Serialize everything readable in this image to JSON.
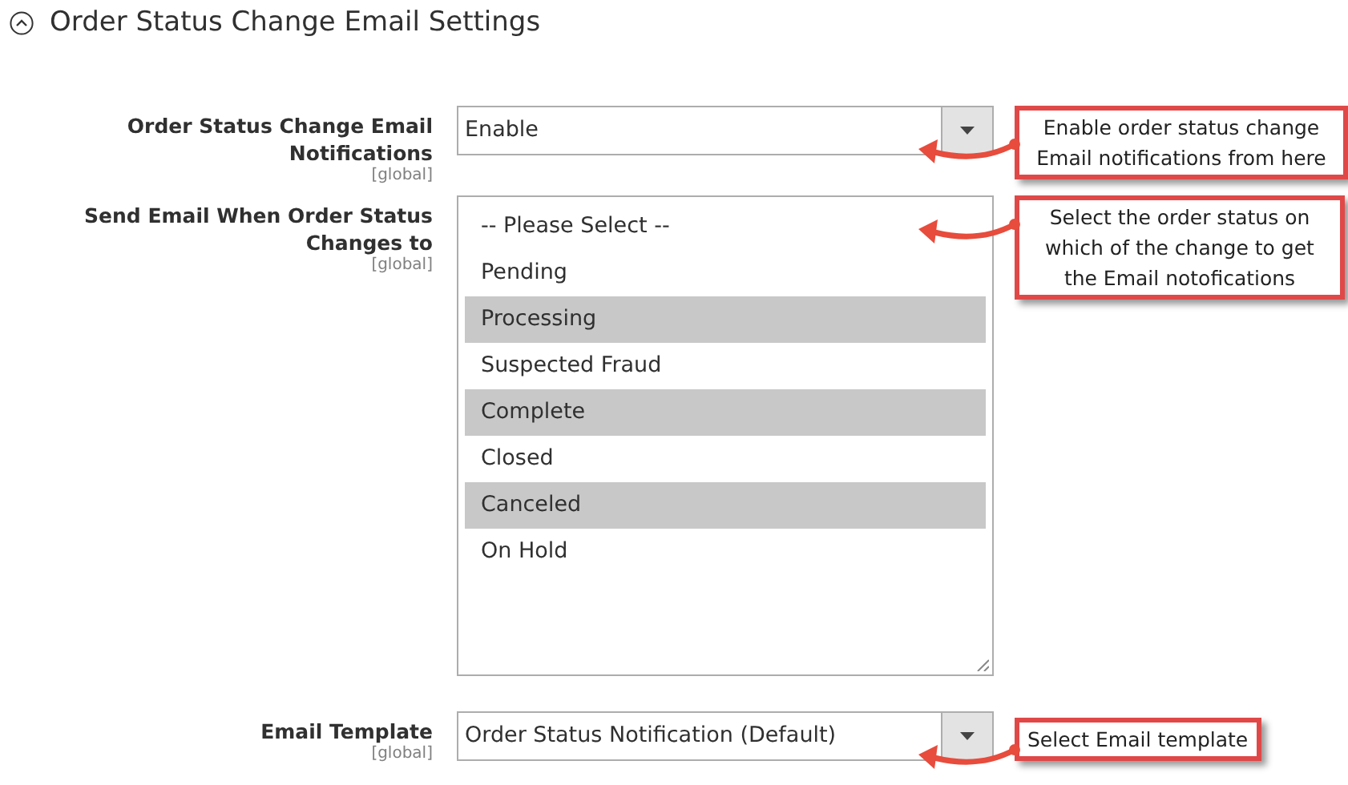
{
  "section": {
    "title": "Order Status Change Email Settings",
    "expanded": true
  },
  "fields": [
    {
      "kind": "select",
      "label": "Order Status Change Email Notifications",
      "scope": "[global]",
      "value": "Enable",
      "callout": "Enable order status change Email notifications from here"
    },
    {
      "kind": "multiselect",
      "label": "Send Email When Order Status Changes to",
      "scope": "[global]",
      "options": [
        {
          "label": "-- Please Select --",
          "selected": false
        },
        {
          "label": "Pending",
          "selected": false
        },
        {
          "label": "Processing",
          "selected": true
        },
        {
          "label": "Suspected Fraud",
          "selected": false
        },
        {
          "label": "Complete",
          "selected": true
        },
        {
          "label": "Closed",
          "selected": false
        },
        {
          "label": "Canceled",
          "selected": true
        },
        {
          "label": "On Hold",
          "selected": false
        }
      ],
      "callout": "Select the order status on which of the change to get the Email notofications"
    },
    {
      "kind": "select",
      "label": "Email Template",
      "scope": "[global]",
      "value": "Order Status Notification (Default)",
      "callout": "Select Email template"
    }
  ]
}
